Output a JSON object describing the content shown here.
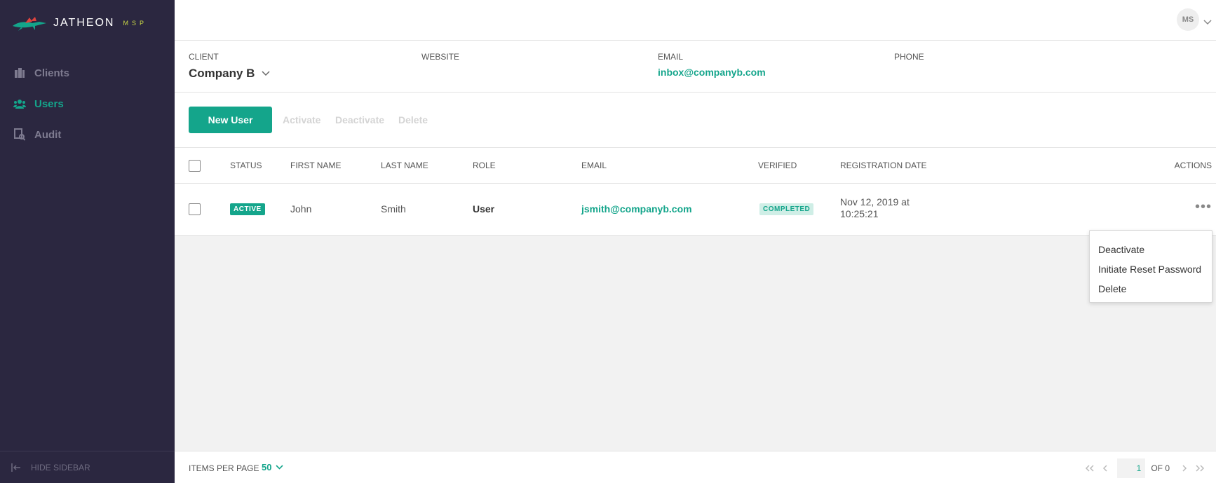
{
  "brand": {
    "name": "JATHEON",
    "sub": "MSP"
  },
  "sidebar": {
    "items": [
      {
        "label": "Clients",
        "icon": "building-icon"
      },
      {
        "label": "Users",
        "icon": "users-icon"
      },
      {
        "label": "Audit",
        "icon": "audit-icon"
      }
    ],
    "hide_label": "HIDE SIDEBAR"
  },
  "header": {
    "avatar_initials": "MS"
  },
  "client": {
    "client_label": "CLIENT",
    "client_name": "Company B",
    "website_label": "WEBSITE",
    "email_label": "EMAIL",
    "email_value": "inbox@companyb.com",
    "phone_label": "PHONE"
  },
  "toolbar": {
    "new_user": "New User",
    "activate": "Activate",
    "deactivate": "Deactivate",
    "delete": "Delete"
  },
  "table": {
    "headers": {
      "status": "STATUS",
      "first_name": "FIRST NAME",
      "last_name": "LAST NAME",
      "role": "ROLE",
      "email": "EMAIL",
      "verified": "VERIFIED",
      "registration_date": "REGISTRATION DATE",
      "actions": "ACTIONS"
    },
    "rows": [
      {
        "status": "ACTIVE",
        "first_name": "John",
        "last_name": "Smith",
        "role": "User",
        "email": "jsmith@companyb.com",
        "verified": "COMPLETED",
        "registration_date_line1": "Nov 12, 2019 at",
        "registration_date_line2": "10:25:21"
      }
    ]
  },
  "actions_menu": {
    "items": [
      "Deactivate",
      "Initiate Reset Password",
      "Delete"
    ]
  },
  "footer": {
    "items_per_page_label": "ITEMS PER PAGE",
    "items_per_page_value": "50",
    "page_value": "1",
    "of_label": "OF 0"
  },
  "colors": {
    "accent": "#14a58b",
    "sidebar_bg": "#2b2740",
    "brand_red": "#e0443e",
    "brand_lime": "#c8d645"
  }
}
